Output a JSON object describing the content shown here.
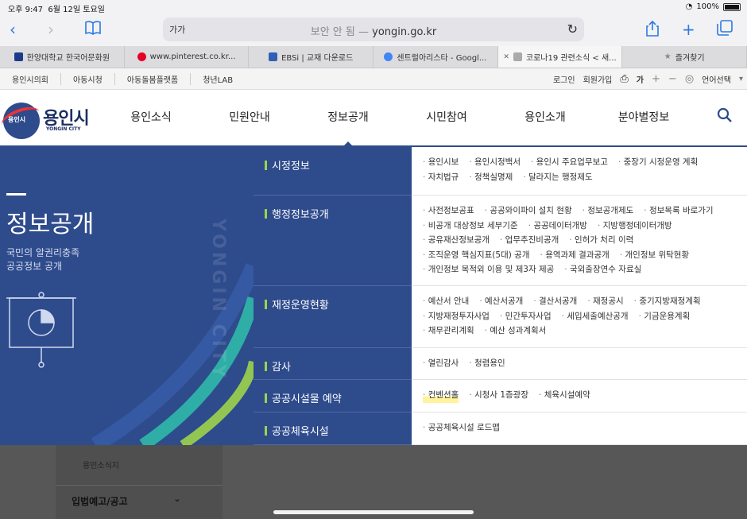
{
  "status": {
    "time": "오후 9:47",
    "date": "6월 12일 토요일",
    "battery": "100%"
  },
  "browser": {
    "aa": "가가",
    "url_insecure": "보안 안 됨 —",
    "url_domain": "yongin.go.kr",
    "tabs": [
      {
        "label": "한양대학교 한국어문화원",
        "color": "#1d3a8a"
      },
      {
        "label": "www.pinterest.co.kr...",
        "color": "#e60023"
      },
      {
        "label": "EBSi | 교재 다운로드",
        "color": "#2f5fb3"
      },
      {
        "label": "센트럴아리스타 - Googl...",
        "color": "#4285f4"
      },
      {
        "label": "코로나19 관련소식 < 새...",
        "color": "#aaaaaa"
      },
      {
        "label": "즐겨찾기",
        "color": "#888888"
      }
    ]
  },
  "utilbar": {
    "left": [
      "용인시의회",
      "아동시청",
      "아동돌봄플랫폼",
      "청년LAB"
    ],
    "login": "로그인",
    "signup": "회원가입",
    "font_size": "가",
    "lang": "언어선택"
  },
  "header": {
    "logo_name": "용인시",
    "logo_ring": "용인시",
    "logo_sub": "YONGIN CITY",
    "menu": [
      "용인소식",
      "민원안내",
      "정보공개",
      "시민참여",
      "용인소개",
      "분야별정보"
    ]
  },
  "hero": {
    "title": "정보공개",
    "desc1": "국민의 알권리충족",
    "desc2": "공공정보 공개",
    "vertical": "YONGIN CITY"
  },
  "mega": [
    {
      "cat": "시정정보",
      "links": [
        "용인시보",
        "용인시정백서",
        "용인시 주요업무보고",
        "중장기 시정운영 계획",
        "자치법규",
        "정책실명제",
        "달라지는 행정제도"
      ]
    },
    {
      "cat": "행정정보공개",
      "links": [
        "사전정보공표",
        "공공와이파이 설치 현황",
        "정보공개제도",
        "정보목록 바로가기",
        "비공개 대상정보 세부기준",
        "공공데이터개방",
        "지방행정데이터개방",
        "공유재산정보공개",
        "업무추진비공개",
        "인허가 처리 이력",
        "조직운영 핵심지표(5대) 공개",
        "용역과제 결과공개",
        "개인정보 위탁현황",
        "개인정보 목적외 이용 및 제3자 제공",
        "국외출장연수 자료실"
      ]
    },
    {
      "cat": "재정운영현황",
      "links": [
        "예산서 안내",
        "예산서공개",
        "결산서공개",
        "재정공시",
        "중기지방재정계획",
        "지방재정투자사업",
        "민간투자사업",
        "세입세출예산공개",
        "기금운용계획",
        "채무관리계획",
        "예산 성과계획서"
      ]
    },
    {
      "cat": "감사",
      "links": [
        "열린감사",
        "청렴용인"
      ]
    },
    {
      "cat": "공공시설물 예약",
      "links": [
        "컨벤션홀",
        "시청사 1층광장",
        "체육시설예약"
      ]
    },
    {
      "cat": "공공체육시설",
      "links": [
        "공공체육시설 로드맵"
      ]
    }
  ],
  "below": {
    "item1": "용인소식지",
    "item2": "입법예고/공고"
  }
}
